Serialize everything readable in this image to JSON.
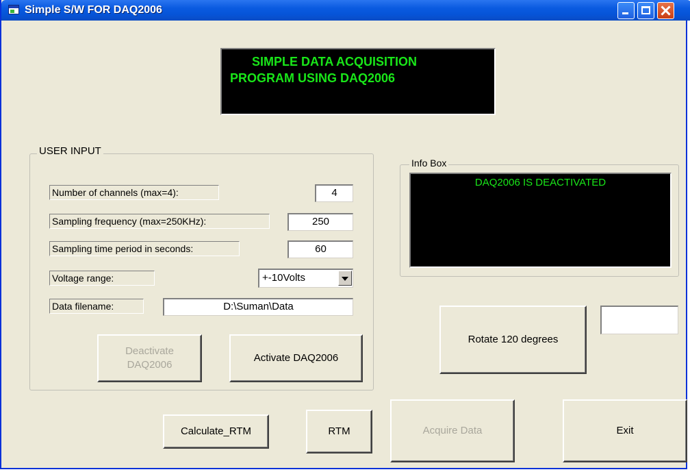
{
  "window": {
    "title": "Simple S/W FOR DAQ2006"
  },
  "banner": {
    "line1": "SIMPLE DATA ACQUISITION",
    "line2": "PROGRAM USING DAQ2006",
    "text_color": "#19e619"
  },
  "user_input": {
    "group_label": "USER INPUT",
    "channels": {
      "label": "Number of channels (max=4):",
      "value": "4"
    },
    "sampling_frequency": {
      "label": "Sampling frequency (max=250KHz):",
      "value": "250"
    },
    "sampling_time": {
      "label": "Sampling time period in seconds:",
      "value": "60"
    },
    "voltage_range": {
      "label": "Voltage range:",
      "selected": "+-10Volts"
    },
    "data_filename": {
      "label": "Data filename:",
      "value": "D:\\Suman\\Data"
    },
    "deactivate_line1": "Deactivate",
    "deactivate_line2": "DAQ2006",
    "activate_label": "Activate DAQ2006"
  },
  "info_box": {
    "label": "Info Box",
    "status": "DAQ2006 IS DEACTIVATED"
  },
  "rotate_button": "Rotate 120 degrees",
  "rotate_value": "",
  "bottom_buttons": {
    "calculate_rtm": "Calculate_RTM",
    "rtm": "RTM",
    "acquire_data": "Acquire Data",
    "exit": "Exit"
  }
}
